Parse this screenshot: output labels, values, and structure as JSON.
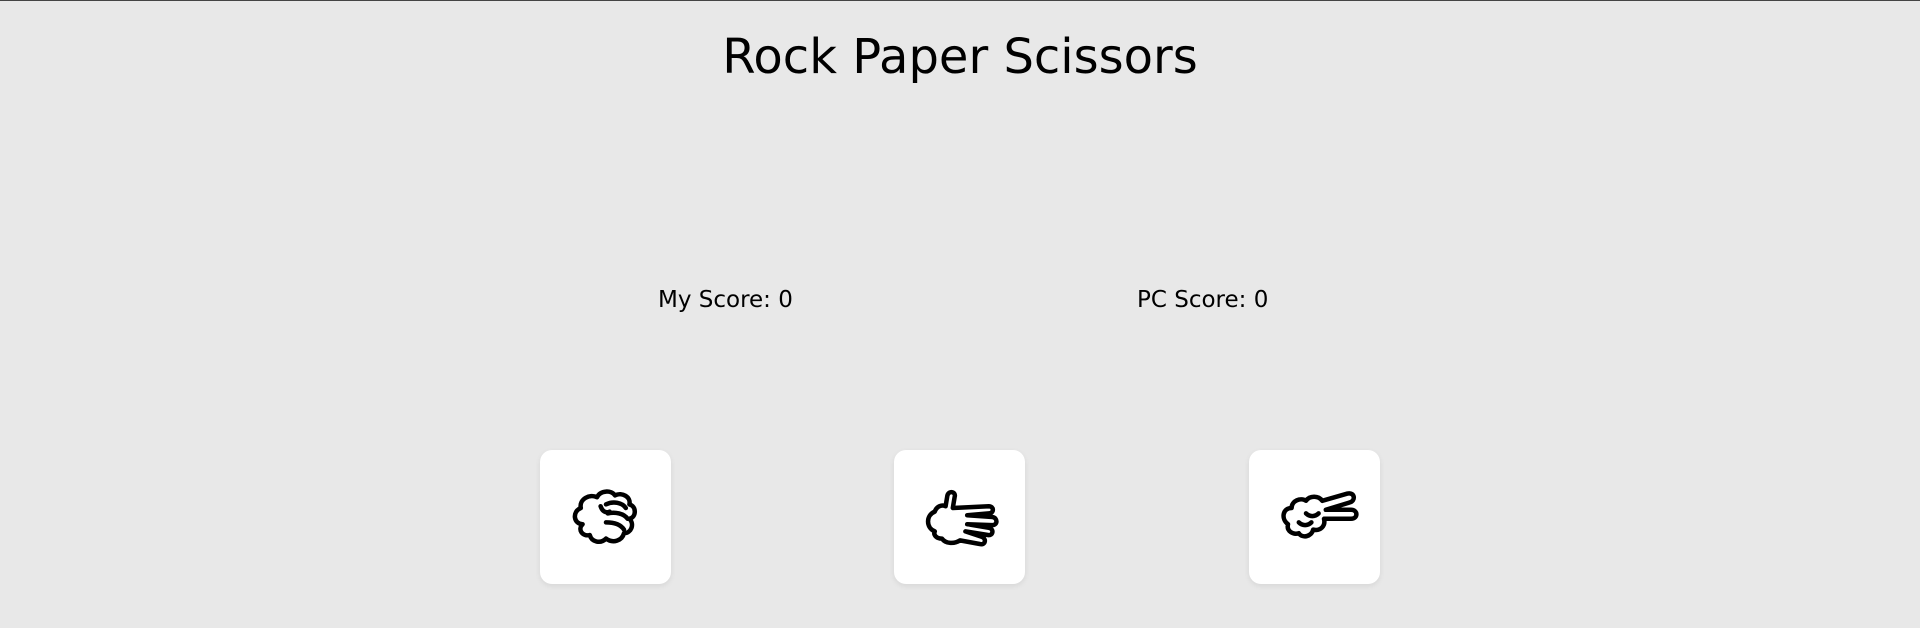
{
  "game": {
    "title": "Rock Paper Scissors"
  },
  "scores": {
    "my_score_label": "My Score: 0",
    "pc_score_label": "PC Score: 0"
  },
  "choices": [
    {
      "icon": "rock-hand-icon"
    },
    {
      "icon": "paper-hand-icon"
    },
    {
      "icon": "scissors-hand-icon"
    }
  ]
}
